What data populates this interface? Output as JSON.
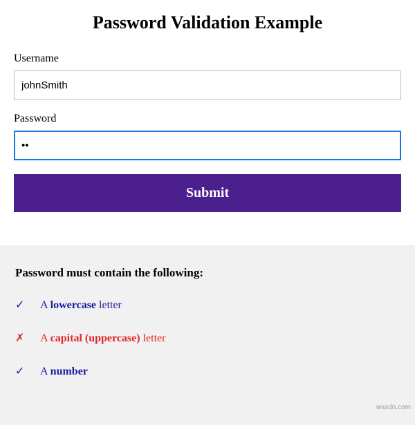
{
  "page": {
    "title": "Password Validation Example"
  },
  "form": {
    "username_label": "Username",
    "username_value": "johnSmith",
    "password_label": "Password",
    "password_value": "••",
    "submit_label": "Submit"
  },
  "rules": {
    "heading": "Password must contain the following:",
    "items": [
      {
        "icon": "✓",
        "status": "valid",
        "prefix": "A ",
        "strong": "lowercase",
        "suffix": " letter"
      },
      {
        "icon": "✗",
        "status": "invalid",
        "prefix": "A ",
        "strong": "capital (uppercase)",
        "suffix": " letter"
      },
      {
        "icon": "✓",
        "status": "valid",
        "prefix": "A ",
        "strong": "number",
        "suffix": ""
      }
    ]
  },
  "watermark": "wsxdn.com"
}
